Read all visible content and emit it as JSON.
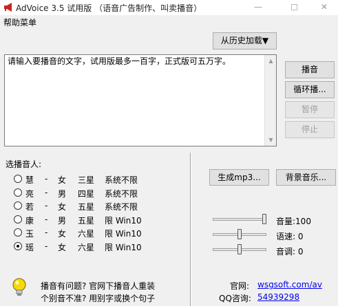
{
  "window": {
    "title": "AdVoice 3.5 试用版 （语音广告制作、叫卖播音）",
    "minimize_glyph": "—",
    "close_glyph": "✕"
  },
  "menu": {
    "help": "帮助菜单"
  },
  "history_button": "从历史加载▼",
  "text_input": {
    "value": "请输入要播音的文字，试用版最多一百字，正式版可五万字。"
  },
  "controls": {
    "play": "播音",
    "loop": "循环播...",
    "pause": "暂停",
    "stop": "停止"
  },
  "speaker_section": {
    "label": "选播音人:",
    "speakers": [
      {
        "name": "慧",
        "dash": "-",
        "gender": "女",
        "star": "三星",
        "limit": "系统不限",
        "selected": false
      },
      {
        "name": "亮",
        "dash": "-",
        "gender": "男",
        "star": "四星",
        "limit": "系统不限",
        "selected": false
      },
      {
        "name": "若",
        "dash": "-",
        "gender": "女",
        "star": "五星",
        "limit": "系统不限",
        "selected": false
      },
      {
        "name": "康",
        "dash": "-",
        "gender": "男",
        "star": "五星",
        "limit": "限 Win10",
        "selected": false
      },
      {
        "name": "玉",
        "dash": "-",
        "gender": "女",
        "star": "六星",
        "limit": "限 Win10",
        "selected": false
      },
      {
        "name": "瑶",
        "dash": "-",
        "gender": "女",
        "star": "六星",
        "limit": "限 Win10",
        "selected": true
      }
    ]
  },
  "generate_button": "生成mp3...",
  "bg_music_button": "背景音乐...",
  "sliders": {
    "volume": {
      "label": "音量:100",
      "value": 100,
      "min": 0,
      "max": 100
    },
    "speed": {
      "label": "语速: 0",
      "value": 0,
      "min": -10,
      "max": 10
    },
    "pitch": {
      "label": "音调: 0",
      "value": 0,
      "min": -10,
      "max": 10
    }
  },
  "help_box": {
    "line1": "播音有问题? 官网下播音人重装",
    "line2": "个别音不准? 用别字或换个句子"
  },
  "info": {
    "site_label": "官网:",
    "site_value": "wsgsoft.com/av",
    "qq_label": "QQ咨询:",
    "qq_value": "54939298"
  },
  "colors": {
    "link": "#0000ee",
    "app_icon": "#cc2222",
    "bulb": "#f5d90a"
  }
}
